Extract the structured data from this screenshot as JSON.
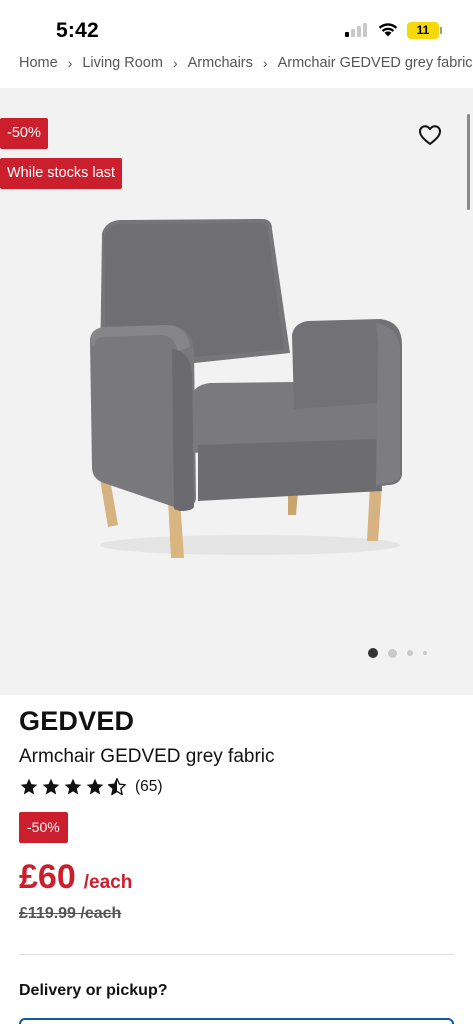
{
  "status_bar": {
    "time": "5:42",
    "battery": "11"
  },
  "breadcrumb": [
    "Home",
    "Living Room",
    "Armchairs",
    "Armchair GEDVED grey fabric"
  ],
  "gallery": {
    "discount_badge": "-50%",
    "stock_badge": "While stocks last",
    "dots_total": 4,
    "active_dot": 1
  },
  "product": {
    "brand": "GEDVED",
    "name": "Armchair GEDVED grey fabric",
    "rating": 4.5,
    "review_count": "(65)",
    "discount_badge": "-50%",
    "price": "£60",
    "price_unit": "/each",
    "old_price": "£119.99 /each"
  },
  "delivery": {
    "heading": "Delivery or pickup?"
  },
  "colors": {
    "sale_red": "#cc1f2d",
    "accent_blue": "#0a5aad"
  }
}
